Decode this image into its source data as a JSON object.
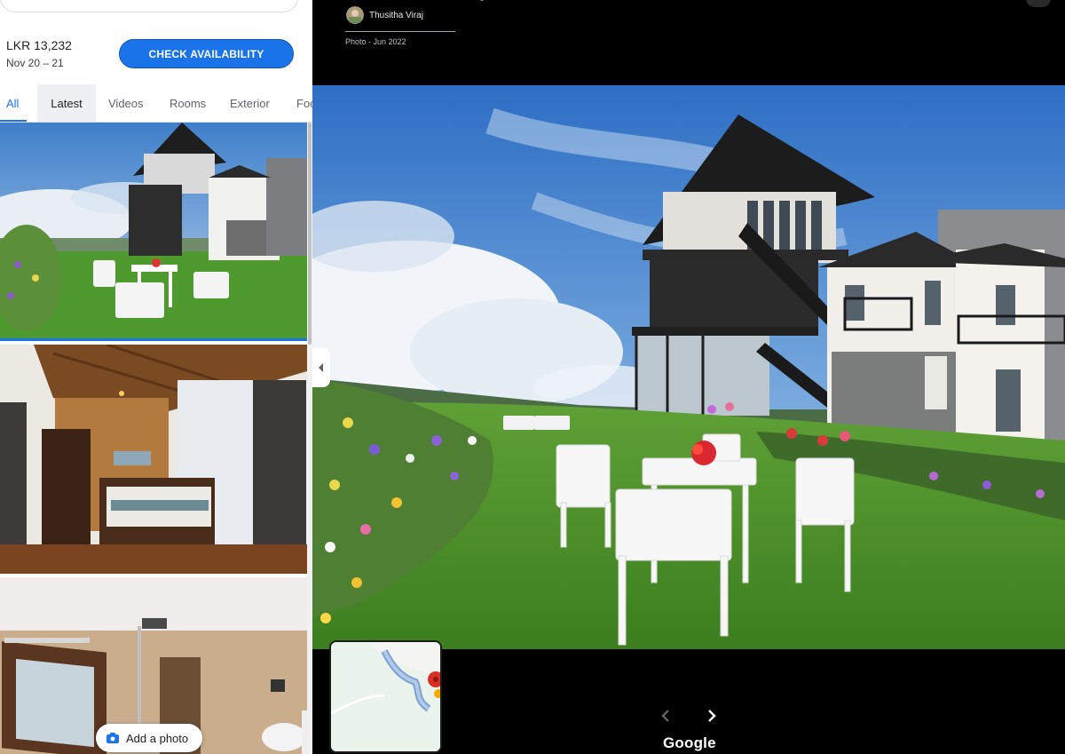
{
  "listing": {
    "price": "LKR 13,232",
    "dates": "Nov 20 – 21",
    "check_button": "CHECK AVAILABILITY"
  },
  "tabs": [
    {
      "label": "All"
    },
    {
      "label": "Latest"
    },
    {
      "label": "Videos"
    },
    {
      "label": "Rooms"
    },
    {
      "label": "Exterior"
    },
    {
      "label": "Foo"
    }
  ],
  "add_photo_label": "Add a photo",
  "viewer": {
    "author": "Thusitha Viraj",
    "photo_date": "Photo - Jun 2022",
    "logo": "Google"
  },
  "icons": {
    "add_photo": "camera-icon",
    "prev": "chevron-left-icon",
    "next": "chevron-right-icon",
    "collapse": "caret-left-icon"
  },
  "colors": {
    "accent": "#1a73e8",
    "viewer_bg": "#000000"
  }
}
